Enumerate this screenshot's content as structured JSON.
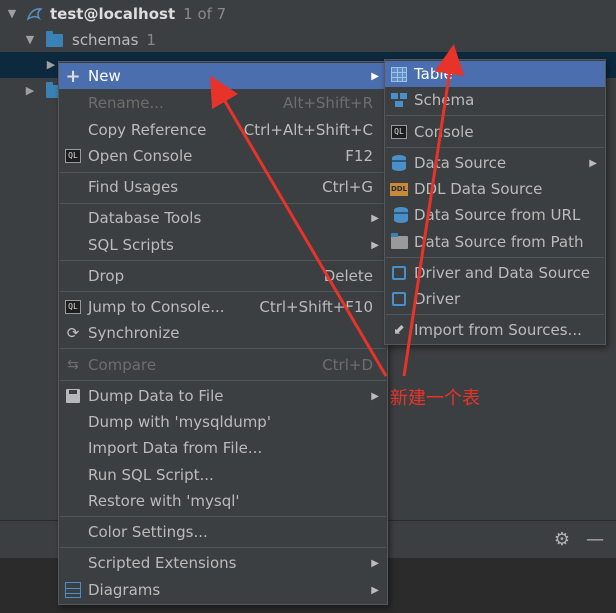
{
  "tree": {
    "host_label": "test@localhost",
    "host_count": "1 of 7",
    "schemas_label": "schemas",
    "schemas_count": "1"
  },
  "context_menu": {
    "items": [
      {
        "label": "New",
        "shortcut": "",
        "submenu": true,
        "icon": "plus-icon",
        "state": "active"
      },
      {
        "label": "Rename...",
        "shortcut": "Alt+Shift+R",
        "icon": "",
        "state": "disabled"
      },
      {
        "label": "Copy Reference",
        "shortcut": "Ctrl+Alt+Shift+C",
        "icon": ""
      },
      {
        "label": "Open Console",
        "shortcut": "F12",
        "icon": "console-icon"
      },
      {
        "label": "Find Usages",
        "shortcut": "Ctrl+G",
        "icon": ""
      },
      {
        "label": "Database Tools",
        "shortcut": "",
        "submenu": true,
        "icon": ""
      },
      {
        "label": "SQL Scripts",
        "shortcut": "",
        "submenu": true,
        "icon": ""
      },
      {
        "label": "Drop",
        "shortcut": "Delete",
        "icon": ""
      },
      {
        "label": "Jump to Console...",
        "shortcut": "Ctrl+Shift+F10",
        "icon": "console-icon"
      },
      {
        "label": "Synchronize",
        "shortcut": "",
        "icon": "sync-icon"
      },
      {
        "label": "Compare",
        "shortcut": "Ctrl+D",
        "icon": "compare-icon",
        "state": "disabled"
      },
      {
        "label": "Dump Data to File",
        "shortcut": "",
        "submenu": true,
        "icon": "floppy-icon"
      },
      {
        "label": "Dump with 'mysqldump'",
        "shortcut": "",
        "icon": ""
      },
      {
        "label": "Import Data from File...",
        "shortcut": "",
        "icon": ""
      },
      {
        "label": "Run SQL Script...",
        "shortcut": "",
        "icon": ""
      },
      {
        "label": "Restore with 'mysql'",
        "shortcut": "",
        "icon": ""
      },
      {
        "label": "Color Settings...",
        "shortcut": "",
        "icon": ""
      },
      {
        "label": "Scripted Extensions",
        "shortcut": "",
        "submenu": true,
        "icon": ""
      },
      {
        "label": "Diagrams",
        "shortcut": "",
        "submenu": true,
        "icon": "diagram-icon"
      }
    ]
  },
  "submenu": {
    "items": [
      {
        "label": "Table",
        "icon": "table-icon",
        "state": "active"
      },
      {
        "label": "Schema",
        "icon": "schema-icon"
      },
      {
        "label": "Console",
        "icon": "console-icon"
      },
      {
        "label": "Data Source",
        "icon": "database-icon",
        "submenu": true
      },
      {
        "label": "DDL Data Source",
        "icon": "ddl-icon"
      },
      {
        "label": "Data Source from URL",
        "icon": "url-icon"
      },
      {
        "label": "Data Source from Path",
        "icon": "folder-icon"
      },
      {
        "label": "Driver and Data Source",
        "icon": "driver-icon"
      },
      {
        "label": "Driver",
        "icon": "driver-icon"
      },
      {
        "label": "Import from Sources...",
        "icon": "import-icon"
      }
    ]
  },
  "annotation": {
    "text": "新建一个表",
    "color": "#e8332b"
  },
  "colors": {
    "panel_bg": "#3c3f41",
    "active_item": "#4b6eaf",
    "text": "#bbbbbb",
    "disabled_text": "#6d6d6d"
  }
}
